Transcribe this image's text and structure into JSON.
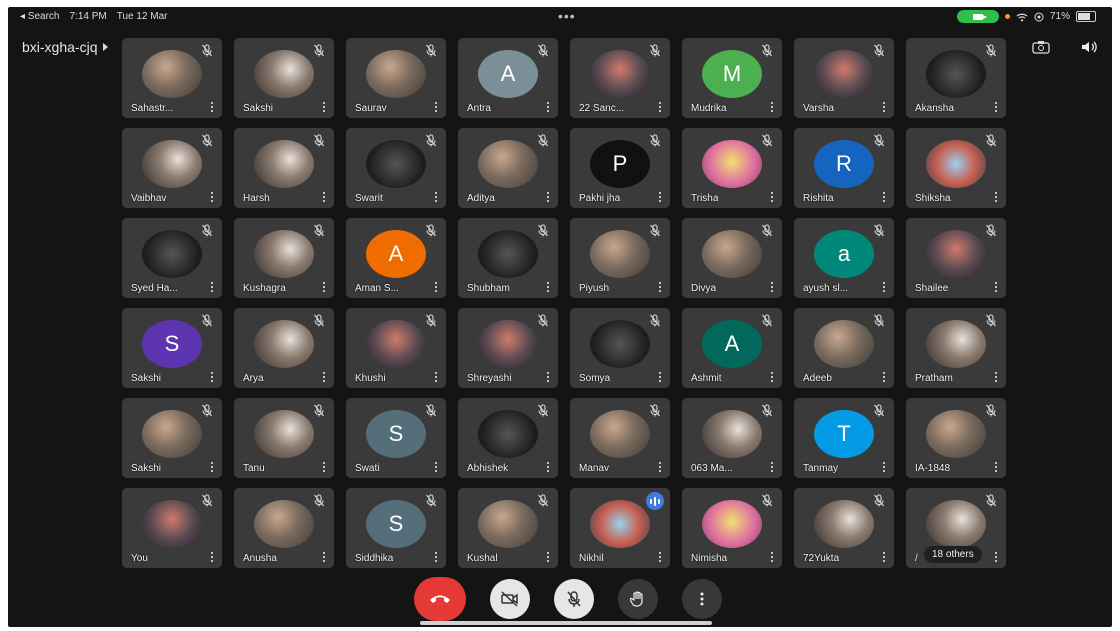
{
  "status_bar": {
    "back_app": "◂ Search",
    "time": "7:14 PM",
    "date": "Tue 12 Mar",
    "dots": "•••",
    "battery": "71%"
  },
  "meeting": {
    "code": "bxi-xgha-cjq"
  },
  "participants": [
    {
      "name": "Sahastr...",
      "avatar": "photo",
      "style": "p1"
    },
    {
      "name": "Sakshi",
      "avatar": "photo",
      "style": "p2"
    },
    {
      "name": "Saurav",
      "avatar": "photo",
      "style": "p1"
    },
    {
      "name": "Antra",
      "avatar": "letter",
      "letter": "A",
      "color": "#7b8f98"
    },
    {
      "name": "22 Sanc...",
      "avatar": "photo",
      "style": "p3"
    },
    {
      "name": "Mudrika",
      "avatar": "letter",
      "letter": "M",
      "color": "#4caf50"
    },
    {
      "name": "Varsha",
      "avatar": "photo",
      "style": "p3"
    },
    {
      "name": "Akansha",
      "avatar": "photo",
      "style": "dark"
    },
    {
      "name": "Vaibhav",
      "avatar": "photo",
      "style": "p2"
    },
    {
      "name": "Harsh",
      "avatar": "photo",
      "style": "p2"
    },
    {
      "name": "Swarit",
      "avatar": "photo",
      "style": "dark"
    },
    {
      "name": "Aditya",
      "avatar": "photo",
      "style": "p1"
    },
    {
      "name": "Pakhi jha",
      "avatar": "letter",
      "letter": "P",
      "color": "#111111"
    },
    {
      "name": "Trisha",
      "avatar": "photo",
      "style": "p5"
    },
    {
      "name": "Rishita",
      "avatar": "letter",
      "letter": "R",
      "color": "#1565c0"
    },
    {
      "name": "Shiksha",
      "avatar": "photo",
      "style": "p4"
    },
    {
      "name": "Syed Ha...",
      "avatar": "photo",
      "style": "dark"
    },
    {
      "name": "Kushagra",
      "avatar": "photo",
      "style": "p2"
    },
    {
      "name": "Aman S...",
      "avatar": "letter",
      "letter": "A",
      "color": "#ef6c00"
    },
    {
      "name": "Shubham",
      "avatar": "photo",
      "style": "dark"
    },
    {
      "name": "Piyush",
      "avatar": "photo",
      "style": "p1"
    },
    {
      "name": "Divya",
      "avatar": "photo",
      "style": "p1"
    },
    {
      "name": "ayush sl...",
      "avatar": "letter",
      "letter": "a",
      "color": "#00897b"
    },
    {
      "name": "Shailee",
      "avatar": "photo",
      "style": "p3"
    },
    {
      "name": "Sakshi",
      "avatar": "letter",
      "letter": "S",
      "color": "#5e35b1"
    },
    {
      "name": "Arya",
      "avatar": "photo",
      "style": "p2"
    },
    {
      "name": "Khushi",
      "avatar": "photo",
      "style": "p3"
    },
    {
      "name": "Shreyashi",
      "avatar": "photo",
      "style": "p3"
    },
    {
      "name": "Somya",
      "avatar": "photo",
      "style": "dark"
    },
    {
      "name": "Ashmit",
      "avatar": "letter",
      "letter": "A",
      "color": "#00695c"
    },
    {
      "name": "Adeeb",
      "avatar": "photo",
      "style": "p1"
    },
    {
      "name": "Pratham",
      "avatar": "photo",
      "style": "p2"
    },
    {
      "name": "Sakshi",
      "avatar": "photo",
      "style": "p1"
    },
    {
      "name": "Tanu",
      "avatar": "photo",
      "style": "p2"
    },
    {
      "name": "Swati",
      "avatar": "letter",
      "letter": "S",
      "color": "#546e7a"
    },
    {
      "name": "Abhishek",
      "avatar": "photo",
      "style": "dark"
    },
    {
      "name": "Manav",
      "avatar": "photo",
      "style": "p1"
    },
    {
      "name": "063 Ma...",
      "avatar": "photo",
      "style": "p2"
    },
    {
      "name": "Tanmay",
      "avatar": "letter",
      "letter": "T",
      "color": "#039be5"
    },
    {
      "name": "IA-1848",
      "avatar": "photo",
      "style": "p1"
    },
    {
      "name": "You",
      "avatar": "photo",
      "style": "p3"
    },
    {
      "name": "Anusha",
      "avatar": "photo",
      "style": "p1"
    },
    {
      "name": "Siddhika",
      "avatar": "letter",
      "letter": "S",
      "color": "#546e7a"
    },
    {
      "name": "Kushal",
      "avatar": "photo",
      "style": "p1"
    },
    {
      "name": "Nikhil",
      "avatar": "photo",
      "style": "p4",
      "speaking": true
    },
    {
      "name": "Nimisha",
      "avatar": "photo",
      "style": "p5"
    },
    {
      "name": "72Yukta",
      "avatar": "photo",
      "style": "p2"
    },
    {
      "name": "/",
      "avatar": "photo",
      "style": "p2",
      "others": "18 others"
    }
  ],
  "controls": {
    "end_call": "end-call",
    "camera": "camera-off",
    "mic": "mic-off",
    "raise_hand": "raise-hand",
    "more": "more-options"
  }
}
